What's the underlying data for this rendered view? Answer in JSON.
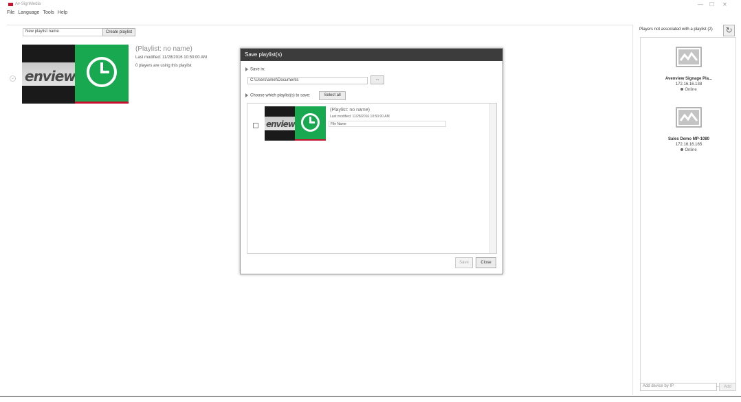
{
  "window": {
    "title": "Av-SignMedia",
    "controls": [
      "—",
      "☐",
      "✕"
    ]
  },
  "menu": [
    "File",
    "Language",
    "Tools",
    "Help"
  ],
  "toolbar": {
    "new_playlist_value": "New playlist name",
    "create_button": "Create playlist"
  },
  "playlist": {
    "name": "(Playlist: no name)",
    "last_modified": "Last modified: 11/28/2016 10:50:00 AM",
    "players_using": "0 players are using this playlist",
    "thumb_text": "enview"
  },
  "dialog": {
    "title": "Save playlist(s)",
    "save_in_label": "Save in:",
    "save_path": "C:\\Users\\amet\\Documents",
    "browse_button": "...",
    "choose_label": "Choose which playlist(s) to save:",
    "select_all_button": "Select all",
    "rows": [
      {
        "name": "(Playlist: no name)",
        "last_modified": "Last modified: 11/28/2016 10:50:00 AM",
        "file_name_placeholder": "File Name",
        "checked": false
      }
    ],
    "save_button": "Save",
    "close_button": "Close"
  },
  "right_panel": {
    "header": "Players not associated with a playlist (2)",
    "refresh_icon": "refresh-icon",
    "players": [
      {
        "name": "Avenview Signage Pla...",
        "ip": "172.16.16.138",
        "status": "Online"
      },
      {
        "name": "Sales Demo MP-1080",
        "ip": "172.16.16.165",
        "status": "Online"
      }
    ],
    "add_device_placeholder": "Add device by IP",
    "add_button": "Add"
  },
  "colors": {
    "accent_green": "#18a84f",
    "accent_red": "#c8102e",
    "dialog_title_bg": "#3c3c3c"
  }
}
